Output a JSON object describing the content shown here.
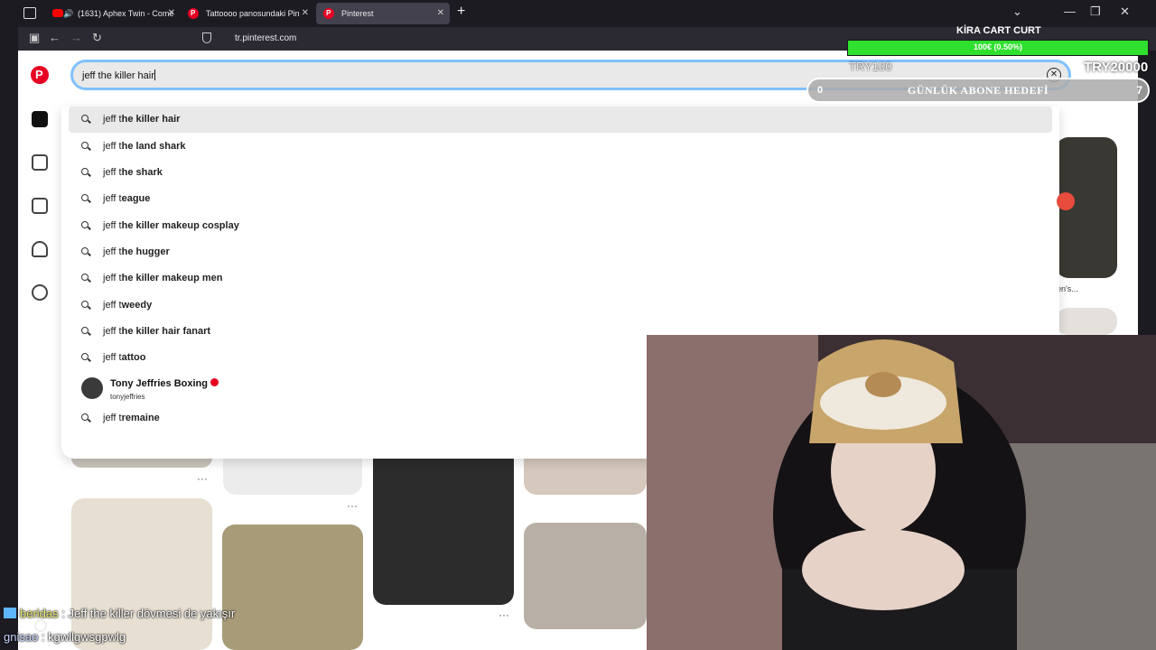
{
  "browser": {
    "tabs": [
      {
        "title": "(1631) Aphex Twin - Come",
        "favicon": "youtube-icon",
        "muted_icon": "speaker-icon"
      },
      {
        "title": "Tattoooo panosundaki Pin",
        "favicon": "pinterest-icon"
      },
      {
        "title": "Pinterest",
        "favicon": "pinterest-icon",
        "active": true
      }
    ],
    "new_tab": "+",
    "url": "tr.pinterest.com",
    "window_controls": [
      "⌄",
      "—",
      "❐",
      "✕"
    ],
    "nav": {
      "back": "←",
      "forward": "→",
      "reload": "↻"
    }
  },
  "search": {
    "query": "jeff the killer hair",
    "clear_label": "✕",
    "suggestions": [
      {
        "prefix": "jeff t",
        "rest": "he killer hair",
        "highlighted": true
      },
      {
        "prefix": "jeff t",
        "rest": "he land shark"
      },
      {
        "prefix": "jeff t",
        "rest": "he shark"
      },
      {
        "prefix": "jeff t",
        "rest": "eague"
      },
      {
        "prefix": "jeff t",
        "rest": "he killer makeup cosplay"
      },
      {
        "prefix": "jeff t",
        "rest": "he hugger"
      },
      {
        "prefix": "jeff t",
        "rest": "he killer makeup men"
      },
      {
        "prefix": "jeff t",
        "rest": "weedy"
      },
      {
        "prefix": "jeff t",
        "rest": "he killer hair fanart"
      },
      {
        "prefix": "jeff t",
        "rest": "attoo"
      }
    ],
    "profile": {
      "name": "Tony Jeffries Boxing",
      "handle": "tonyjeffries"
    },
    "last_suggestion": {
      "prefix": "jeff t",
      "rest": "remaine"
    }
  },
  "background": {
    "pin_caption": "en's..."
  },
  "overlay": {
    "title": "KİRA CART CURT",
    "donation": {
      "progress_text": "100€ (0.50%)",
      "progress": 0.005,
      "min": "TRY100",
      "max": "TRY20000"
    },
    "sub_goal": {
      "current": "0",
      "label": "GÜNLÜK ABONE HEDEFİ",
      "target": "7"
    }
  },
  "chat": [
    {
      "user": "beridas",
      "message": " : Jeff the killer dövmesi de yakışır"
    },
    {
      "user": "gnisao",
      "message": " : kgwllgwsgpwlg"
    }
  ],
  "colors": {
    "pinterest_red": "#e60023",
    "focus_ring": "#7fc1ff",
    "donation_green": "#2fe02f",
    "chrome_bg": "#1c1b22"
  }
}
